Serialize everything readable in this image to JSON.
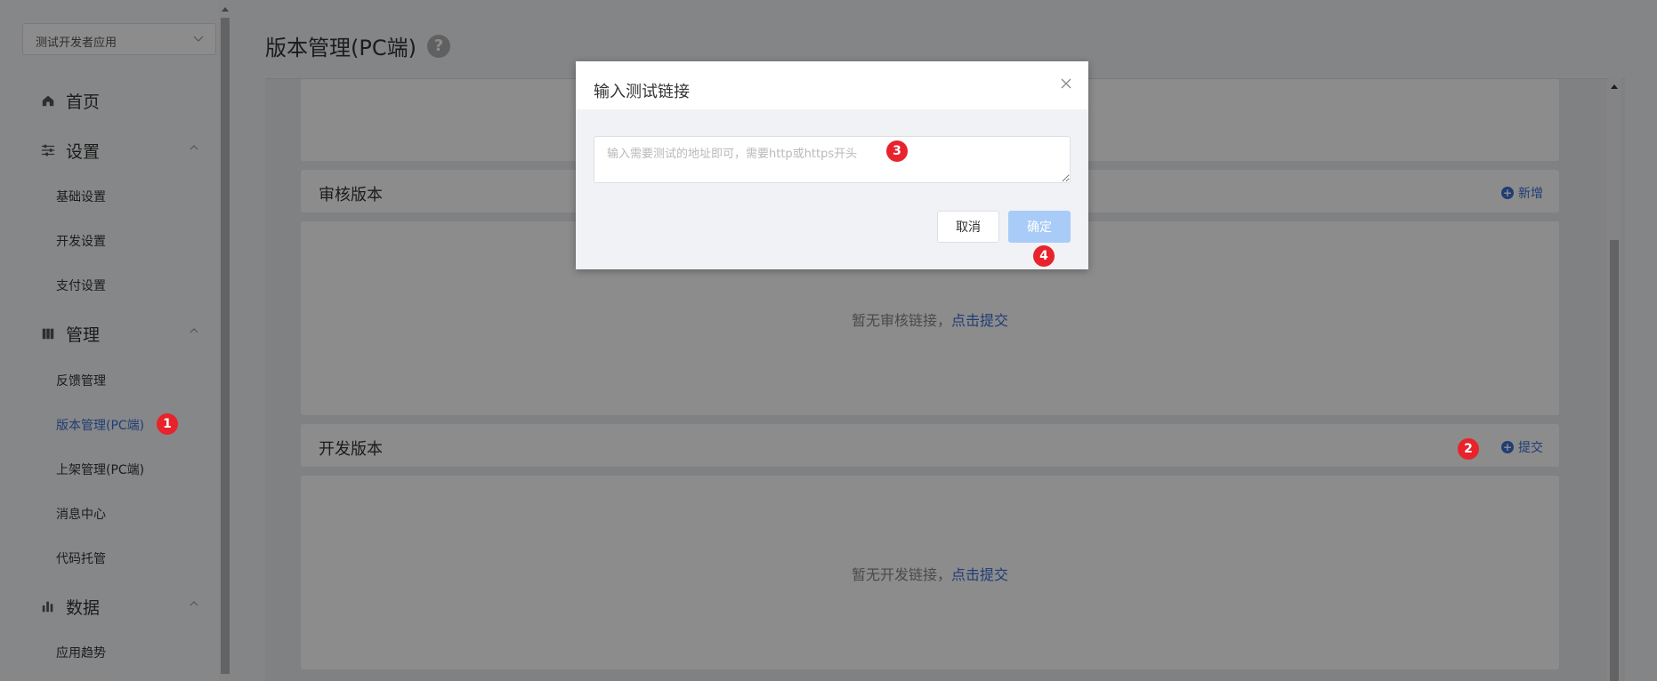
{
  "sidebar": {
    "app_select": "测试开发者应用",
    "home_label": "首页",
    "settings": {
      "label": "设置",
      "items": [
        "基础设置",
        "开发设置",
        "支付设置"
      ]
    },
    "manage": {
      "label": "管理",
      "items": [
        "反馈管理",
        "版本管理(PC端)",
        "上架管理(PC端)",
        "消息中心",
        "代码托管"
      ]
    },
    "data": {
      "label": "数据",
      "items": [
        "应用趋势"
      ]
    }
  },
  "main": {
    "title": "版本管理(PC端)",
    "help": "?",
    "review_section": {
      "title": "审核版本",
      "action": "新增",
      "empty_text": "暂无审核链接，",
      "empty_link": "点击提交"
    },
    "dev_section": {
      "title": "开发版本",
      "action": "提交",
      "empty_text": "暂无开发链接，",
      "empty_link": "点击提交"
    }
  },
  "dialog": {
    "title": "输入测试链接",
    "input_placeholder": "输入需要测试的地址即可，需要http或https开头",
    "input_value": "",
    "cancel_label": "取消",
    "ok_label": "确定"
  },
  "markers": [
    "1",
    "2",
    "3",
    "4"
  ],
  "colors": {
    "accent": "#3b6fd6",
    "marker": "#e8232b",
    "ok_disabled": "#a9cbf7"
  }
}
